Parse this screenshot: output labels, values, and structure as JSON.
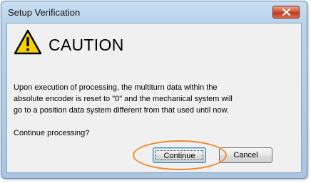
{
  "window": {
    "title": "Setup Verification",
    "close_icon": "close-icon"
  },
  "dialog": {
    "icon": "warning-triangle-icon",
    "heading": "CAUTION",
    "message_lines": [
      "Upon execution of processing, the multiturn data within the",
      "absolute encoder is reset to \"0\" and the mechanical system will",
      "go to a position data system different from that used until now."
    ],
    "prompt": "Continue processing?",
    "continue_label": "Continue",
    "cancel_label": "Cancel"
  },
  "colors": {
    "highlight_ring": "#f0882a",
    "warning_fill": "#f7d200",
    "close_button": "#c9472b"
  }
}
